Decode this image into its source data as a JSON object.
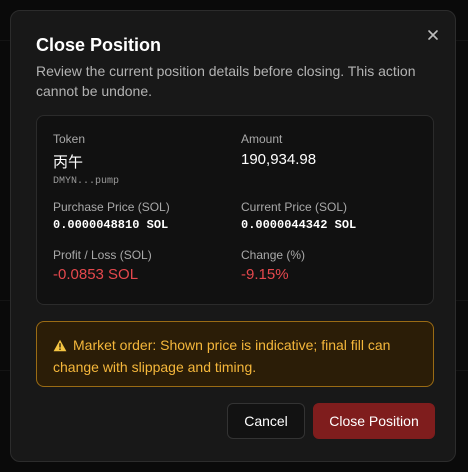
{
  "dialog": {
    "title": "Close Position",
    "description": "Review the current position details before closing. This action cannot be undone."
  },
  "details": {
    "token_label": "Token",
    "token_name": "丙午",
    "token_address": "DMYN...pump",
    "amount_label": "Amount",
    "amount_value": "190,934.98",
    "purchase_price_label": "Purchase Price (SOL)",
    "purchase_price_value": "0.0000048810 SOL",
    "current_price_label": "Current Price (SOL)",
    "current_price_value": "0.0000044342 SOL",
    "pnl_label": "Profit / Loss (SOL)",
    "pnl_value": "-0.0853 SOL",
    "change_label": "Change (%)",
    "change_value": "-9.15%"
  },
  "warning": {
    "icon": "warning-icon",
    "text": "Market order: Shown price is indicative; final fill can change with slippage and timing."
  },
  "actions": {
    "cancel_label": "Cancel",
    "confirm_label": "Close Position"
  },
  "colors": {
    "negative": "#e5484d",
    "warning_text": "#f5b73b",
    "warning_bg": "#2b1d07",
    "confirm_bg": "#7f1d1d"
  }
}
